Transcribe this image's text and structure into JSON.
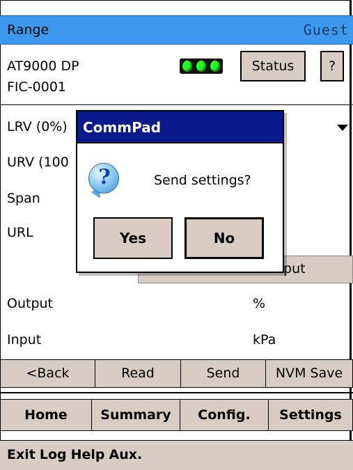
{
  "title_bar": {
    "screen_name": "Range",
    "user": "Guest"
  },
  "device": {
    "model": "AT9000 DP",
    "tag": "FIC-0001"
  },
  "buttons": {
    "status": "Status",
    "help": "?"
  },
  "rows": {
    "lrv_label": "LRV (0%)",
    "urv_label": "URV (100",
    "span_label": "Span",
    "url_label": "URL",
    "input_button": "nput",
    "output_label": "Output",
    "output_unit": "%",
    "input_label": "Input",
    "input_unit": "kPa"
  },
  "action_bar": [
    "<Back",
    "Read",
    "Send",
    "NVM Save"
  ],
  "nav_bar": [
    "Home",
    "Summary",
    "Config.",
    "Settings"
  ],
  "menu_bar": [
    "Exit",
    "Log",
    "Help",
    "Aux."
  ],
  "dialog": {
    "title": "CommPad",
    "message": "Send settings?",
    "icon": "question-icon",
    "yes": "Yes",
    "no": "No"
  },
  "colors": {
    "title_bar": "#3d99ef",
    "dialog_title": "#0a1a8c",
    "button_face": "#d9cdc3",
    "led_on": "#22ff22"
  }
}
